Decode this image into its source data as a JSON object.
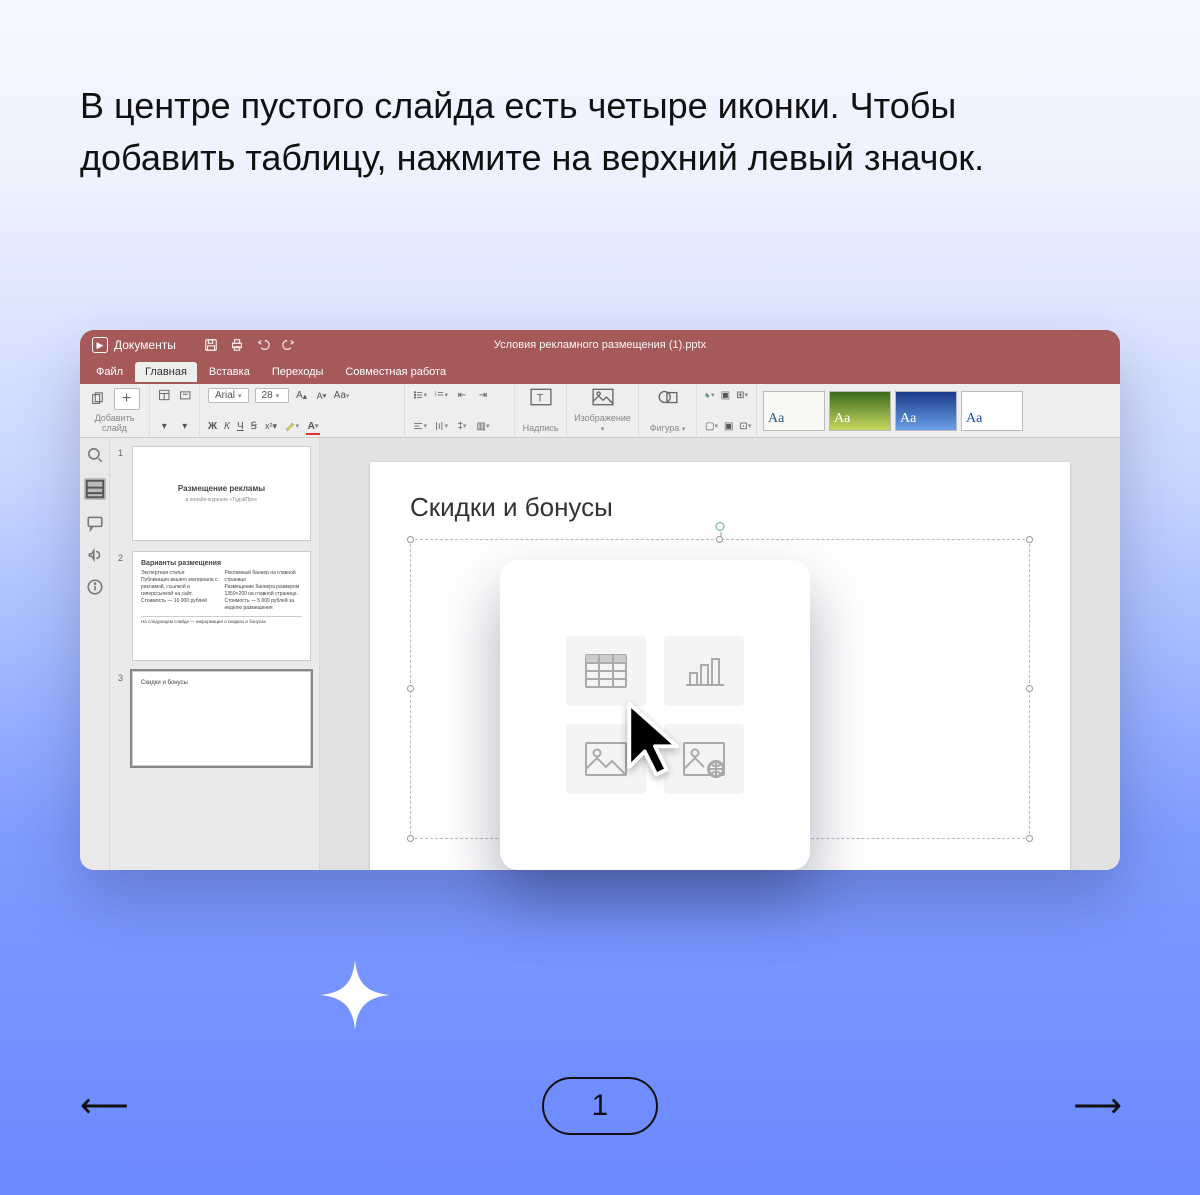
{
  "instruction": "В центре пустого слайда есть четыре иконки. Чтобы добавить таблицу, нажмите на верхний левый значок.",
  "app": {
    "brand": "Документы",
    "doc_title": "Условия рекламного размещения (1).pptx",
    "menu": {
      "file": "Файл",
      "home": "Главная",
      "insert": "Вставка",
      "transitions": "Переходы",
      "collab": "Совместная работа"
    },
    "ribbon": {
      "add_slide": "Добавить слайд",
      "font_name": "Arial",
      "font_size": "28",
      "caption": "Надпись",
      "image": "Изображение",
      "shape": "Фигура",
      "bold": "Ж",
      "italic": "К",
      "underline": "Ч",
      "strike": "Ꞩ",
      "theme_aa": "Aa"
    },
    "thumbs": [
      {
        "num": "1",
        "title": "Размещение рекламы",
        "sub": "в онлайн-журнале «ТудэйПро»"
      },
      {
        "num": "2",
        "title": "Варианты размещения",
        "col1": "Экспертная статья\nПубликация вашего материала с рекламой, ссылкой и гиперссылкой на сайт.\nСтоимость — 10 000 рублей",
        "col2": "Рекламный баннер на главной странице\nРазмещение баннера размером 1350×200 на главной странице.\nСтоимость — 5 000 рублей за неделю размещения",
        "footer": "На следующем слайде — информация о скидках и бонусах"
      },
      {
        "num": "3",
        "title": "Скидки и бонусы"
      }
    ],
    "slide_title": "Скидки и бонусы",
    "popup_icons": {
      "table": "table-icon",
      "chart": "bar-chart-icon",
      "picture": "picture-icon",
      "online_picture": "online-picture-icon"
    }
  },
  "pager": {
    "current": "1"
  }
}
